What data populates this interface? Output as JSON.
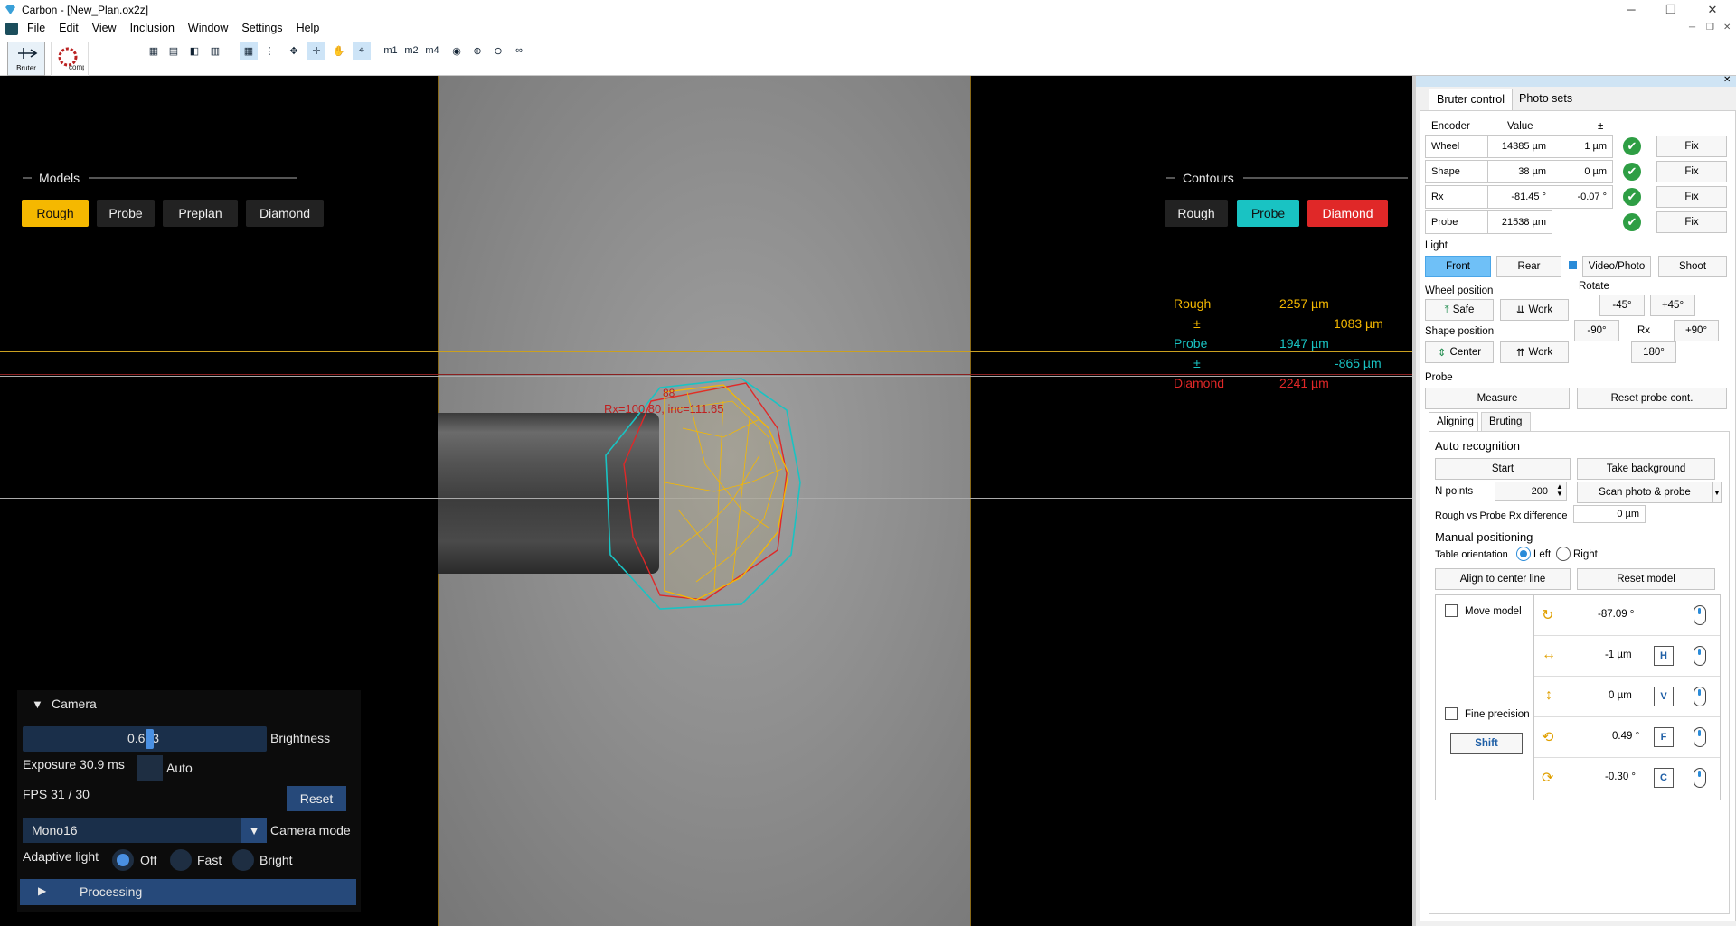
{
  "window": {
    "title": "Carbon - [New_Plan.ox2z]"
  },
  "menu": [
    "File",
    "Edit",
    "View",
    "Inclusion",
    "Window",
    "Settings",
    "Help"
  ],
  "toolbar": {
    "bruter_label": "Bruter",
    "comp_report_label": "Comp report",
    "m_labels": [
      "m1",
      "m2",
      "m4"
    ]
  },
  "models": {
    "heading": "Models",
    "items": [
      "Rough",
      "Probe",
      "Preplan",
      "Diamond"
    ],
    "active": "Rough"
  },
  "contours": {
    "heading": "Contours",
    "items": [
      "Rough",
      "Probe",
      "Diamond"
    ]
  },
  "colors": {
    "rough": "#f5b800",
    "probe": "#19c3c3",
    "diamond": "#e02828",
    "accent": "#4a90e2"
  },
  "measurements": {
    "rough_label": "Rough",
    "rough_value": "2257 µm",
    "rough_pm": "±",
    "rough_pm_value": "1083 µm",
    "probe_label": "Probe",
    "probe_value": "1947 µm",
    "probe_pm": "±",
    "probe_pm_value": "-865 µm",
    "diamond_label": "Diamond",
    "diamond_value": "2241 µm"
  },
  "overlay": {
    "label1": "88",
    "label2": "Rx=100.80, inc=111.65"
  },
  "camera": {
    "heading": "Camera",
    "brightness_value": "0.673",
    "brightness_fraction": 0.673,
    "brightness_label": "Brightness",
    "exposure": "Exposure 30.9 ms",
    "auto_label": "Auto",
    "fps": "FPS  31 /  30",
    "reset_label": "Reset",
    "mode_value": "Mono16",
    "mode_label": "Camera mode",
    "adaptive_label": "Adaptive light",
    "adaptive_options": [
      "Off",
      "Fast",
      "Bright"
    ],
    "adaptive_selected": "Off",
    "processing_label": "Processing"
  },
  "right": {
    "tabs": [
      "Bruter control",
      "Photo sets"
    ],
    "encoder_headers": [
      "Encoder",
      "Value",
      "±"
    ],
    "encoders": [
      {
        "name": "Wheel",
        "value": "14385 µm",
        "pm": "1 µm",
        "fix": "Fix"
      },
      {
        "name": "Shape",
        "value": "38 µm",
        "pm": "0 µm",
        "fix": "Fix"
      },
      {
        "name": "Rx",
        "value": "-81.45 °",
        "pm": "-0.07 °",
        "fix": "Fix"
      },
      {
        "name": "Probe",
        "value": "21538 µm",
        "pm": "",
        "fix": "Fix"
      }
    ],
    "light_label": "Light",
    "front": "Front",
    "rear": "Rear",
    "video_photo": "Video/Photo",
    "shoot": "Shoot",
    "rotate_label": "Rotate",
    "rot_m45": "-45°",
    "rot_p45": "+45°",
    "rot_m90": "-90°",
    "rx_label": "Rx",
    "rot_p90": "+90°",
    "rot_180": "180°",
    "wheel_pos_label": "Wheel position",
    "wheel_safe": "Safe",
    "wheel_work": "Work",
    "shape_pos_label": "Shape position",
    "shape_center": "Center",
    "shape_work": "Work",
    "probe_label": "Probe",
    "measure": "Measure",
    "reset_probe": "Reset probe cont.",
    "subtabs": [
      "Aligning",
      "Bruting"
    ],
    "auto_recog": "Auto recognition",
    "start": "Start",
    "take_bg": "Take background",
    "npoints_label": "N points",
    "npoints_value": "200",
    "scan_option": "Scan photo & probe",
    "rx_diff_label": "Rough vs Probe Rx difference",
    "rx_diff_value": "0 µm",
    "manual_pos": "Manual positioning",
    "table_orient": "Table orientation",
    "left": "Left",
    "right": "Right",
    "align_center": "Align to center line",
    "reset_model": "Reset model",
    "move_model": "Move model",
    "fine_precision": "Fine precision",
    "shift": "Shift",
    "controls": [
      {
        "value": "-87.09 °",
        "key": ""
      },
      {
        "value": "-1 µm",
        "key": "H"
      },
      {
        "value": "0 µm",
        "key": "V"
      },
      {
        "value": "0.49 °",
        "key": "F"
      },
      {
        "value": "-0.30 °",
        "key": "C"
      }
    ]
  }
}
